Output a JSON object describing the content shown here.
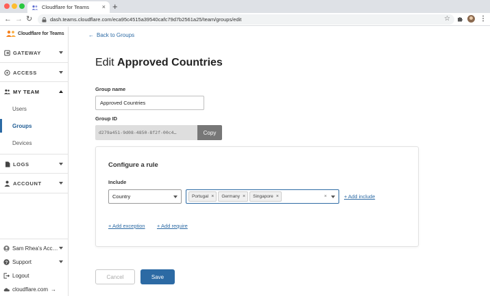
{
  "browser": {
    "tab_title": "Cloudflare for Teams",
    "tab_close": "×",
    "new_tab": "+",
    "url": "dash.teams.cloudflare.com/eca95c4515a39540cafc79d7b2561a25/team/groups/edit"
  },
  "sidebar": {
    "logo_text": "Cloudflare for Teams",
    "sections": [
      {
        "label": "GATEWAY"
      },
      {
        "label": "ACCESS"
      },
      {
        "label": "MY TEAM"
      },
      {
        "label": "LOGS"
      },
      {
        "label": "ACCOUNT"
      }
    ],
    "my_team_items": [
      {
        "label": "Users"
      },
      {
        "label": "Groups"
      },
      {
        "label": "Devices"
      }
    ],
    "footer": {
      "account": "Sam Rhea's Account",
      "support": "Support",
      "logout": "Logout",
      "site_link": "cloudflare.com",
      "site_arrow": "→"
    }
  },
  "main": {
    "back_arrow": "←",
    "back_link": "Back to Groups",
    "title_prefix": "Edit",
    "title_name": "Approved Countries",
    "group_name_label": "Group name",
    "group_name_value": "Approved Countries",
    "group_id_label": "Group ID",
    "group_id_value": "d279a451-9d08-4850-8f2f-00c4…",
    "copy_label": "Copy",
    "rule": {
      "title": "Configure a rule",
      "include_label": "Include",
      "selector_value": "Country",
      "chips": [
        "Portugal",
        "Germany",
        "Singapore"
      ],
      "chip_remove": "×",
      "clear": "×",
      "add_include": "+ Add include",
      "add_exception": "+ Add exception",
      "add_require": "+ Add require"
    },
    "cancel_label": "Cancel",
    "save_label": "Save"
  },
  "colors": {
    "accent": "#2c6aa4",
    "copy_button": "#777777",
    "id_box": "#dedede"
  }
}
